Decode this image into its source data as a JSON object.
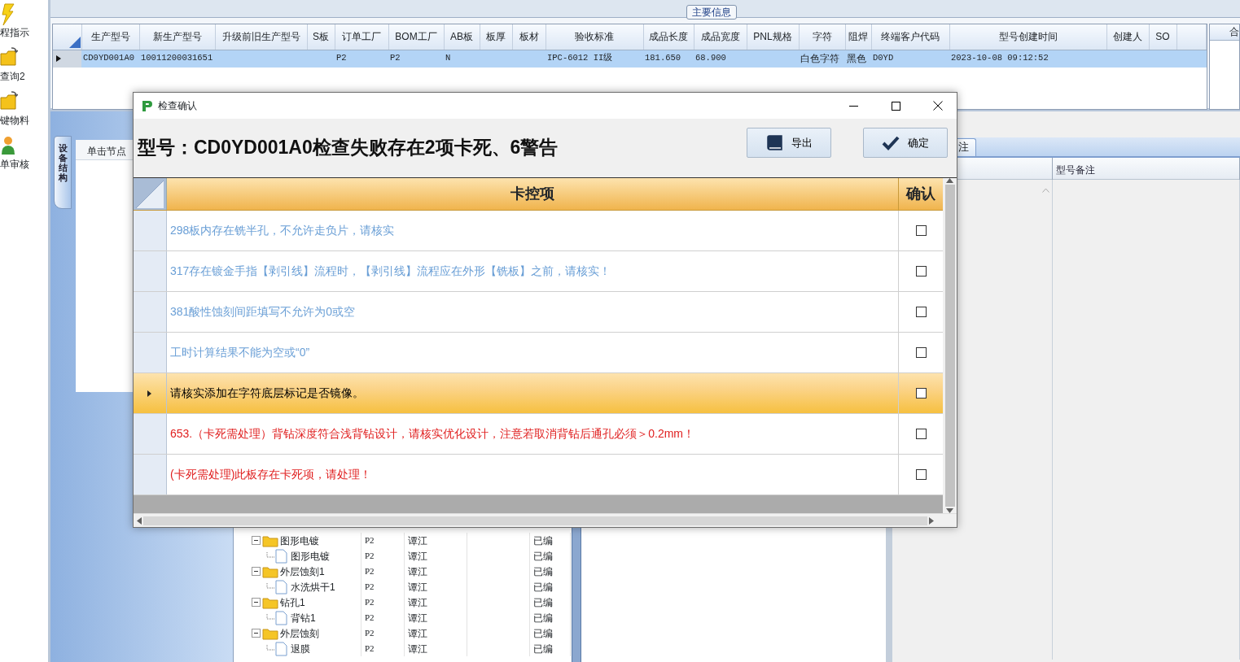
{
  "sidebar": {
    "items": [
      {
        "label": "程指示",
        "kind": "lightning"
      },
      {
        "label": "查询2",
        "kind": "folder"
      },
      {
        "label": "键物料",
        "kind": "folder"
      },
      {
        "label": "单审核",
        "kind": "person"
      }
    ]
  },
  "main_info": {
    "legend": "主要信息",
    "columns": [
      "生产型号",
      "新生产型号",
      "升级前旧生产型号",
      "S板",
      "订单工厂",
      "BOM工厂",
      "AB板",
      "板厚",
      "板材",
      "验收标准",
      "成品长度",
      "成品宽度",
      "PNL规格",
      "字符",
      "阻焊",
      "终端客户代码",
      "型号创建时间",
      "创建人",
      "SO"
    ],
    "rows": [
      {
        "selected": true,
        "cells": [
          "CD0YD001A0",
          "10011200031651",
          "",
          "",
          "P2",
          "P2",
          "N",
          "",
          "",
          "IPC-6012 II级",
          "181.650",
          "68.900",
          "",
          "白色字符",
          "黑色",
          "D0YD",
          "2023-10-08 09:12:52",
          "",
          ""
        ]
      }
    ]
  },
  "side_panel": {
    "header": "合"
  },
  "lower": {
    "vertical_tab": "设备结构",
    "node_hint": "单击节点",
    "right_tab": "注",
    "remark_header": "型号备注",
    "tree_rows": [
      {
        "kind": "folder",
        "name": "图形电镀",
        "factory": "P2",
        "person": "谭江",
        "status": "已编"
      },
      {
        "kind": "file",
        "name": "图形电镀",
        "factory": "P2",
        "person": "谭江",
        "status": "已编"
      },
      {
        "kind": "folder",
        "name": "外层蚀刻1",
        "factory": "P2",
        "person": "谭江",
        "status": "已编"
      },
      {
        "kind": "file",
        "name": "水洗烘干1",
        "factory": "P2",
        "person": "谭江",
        "status": "已编"
      },
      {
        "kind": "folder",
        "name": "钻孔1",
        "factory": "P2",
        "person": "谭江",
        "status": "已编"
      },
      {
        "kind": "file",
        "name": "背钻1",
        "factory": "P2",
        "person": "谭江",
        "status": "已编"
      },
      {
        "kind": "folder",
        "name": "外层蚀刻",
        "factory": "P2",
        "person": "谭江",
        "status": "已编"
      },
      {
        "kind": "file",
        "name": "退膜",
        "factory": "P2",
        "person": "谭江",
        "status": "已编"
      }
    ]
  },
  "dialog": {
    "title": "检查确认",
    "heading": "型号：CD0YD001A0检查失败存在2项卡死、6警告",
    "buttons": [
      {
        "label": "导出",
        "kind": "export"
      },
      {
        "label": "确定",
        "kind": "confirm"
      }
    ],
    "columns": [
      "卡控项",
      "确认"
    ],
    "rows": [
      {
        "text": "298板内存在铣半孔，不允许走负片，请核实",
        "color": "#6a9fd6",
        "selected": false,
        "checked": false
      },
      {
        "text": "317存在镀金手指【剥引线】流程时，【剥引线】流程应在外形【铣板】之前，请核实！",
        "color": "#6a9fd6",
        "selected": false,
        "checked": false
      },
      {
        "text": "381酸性蚀刻间距填写不允许为0或空",
        "color": "#6a9fd6",
        "selected": false,
        "checked": false
      },
      {
        "text": "工时计算结果不能为空或“0”",
        "color": "#6a9fd6",
        "selected": false,
        "checked": false
      },
      {
        "text": "请核实添加在字符底层标记是否镜像。",
        "color": "#000000",
        "selected": true,
        "checked": false
      },
      {
        "text": "653.（卡死需处理）背钻深度符合浅背钻设计，请核实优化设计，注意若取消背钻后通孔必须＞0.2mm！",
        "color": "#e02020",
        "selected": false,
        "checked": false
      },
      {
        "text": "(卡死需处理)此板存在卡死项，请处理！",
        "color": "#e02020",
        "selected": false,
        "checked": false
      }
    ]
  }
}
